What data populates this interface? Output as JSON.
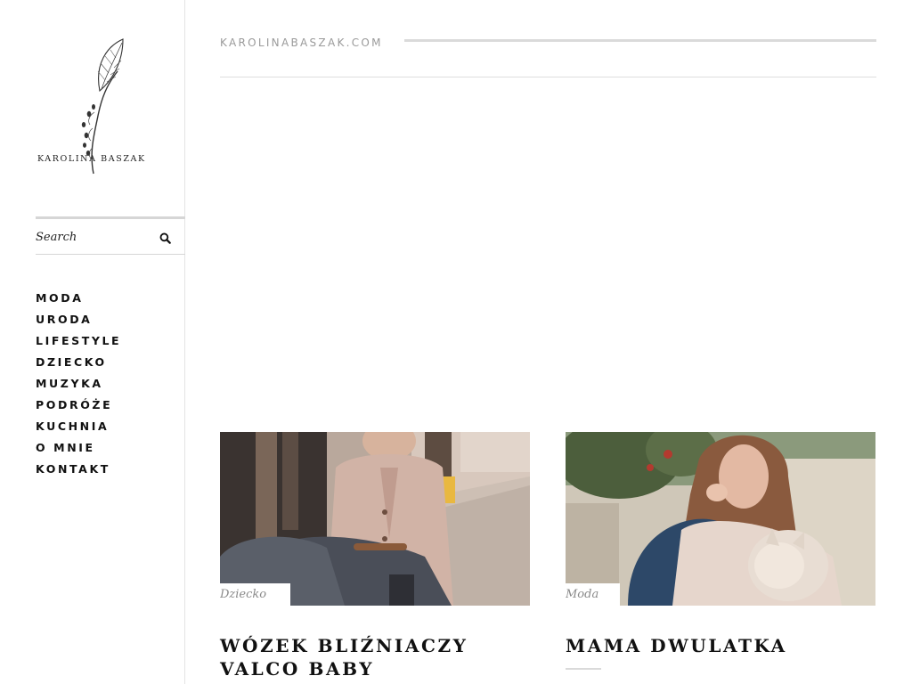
{
  "site": {
    "logo_text": "KAROLINA BASZAK",
    "url_text": "KAROLINABASZAK.COM"
  },
  "search": {
    "placeholder": "Search",
    "icon": "search-icon"
  },
  "nav": {
    "items": [
      {
        "label": "MODA"
      },
      {
        "label": "URODA"
      },
      {
        "label": "LIFESTYLE"
      },
      {
        "label": "DZIECKO"
      },
      {
        "label": "MUZYKA"
      },
      {
        "label": "PODRÓŻE"
      },
      {
        "label": "KUCHNIA"
      },
      {
        "label": "O MNIE"
      },
      {
        "label": "KONTAKT"
      }
    ]
  },
  "posts": [
    {
      "category": "Dziecko",
      "title": "WÓZEK BLIŹNIACZY VALCO BABY",
      "image": "woman-with-twin-stroller-photo"
    },
    {
      "category": "Moda",
      "title": "MAMA DWULATKA",
      "image": "mother-holding-toddler-photo"
    }
  ],
  "colors": {
    "text": "#111111",
    "muted": "#9a9a9a",
    "rule": "#dadada"
  }
}
